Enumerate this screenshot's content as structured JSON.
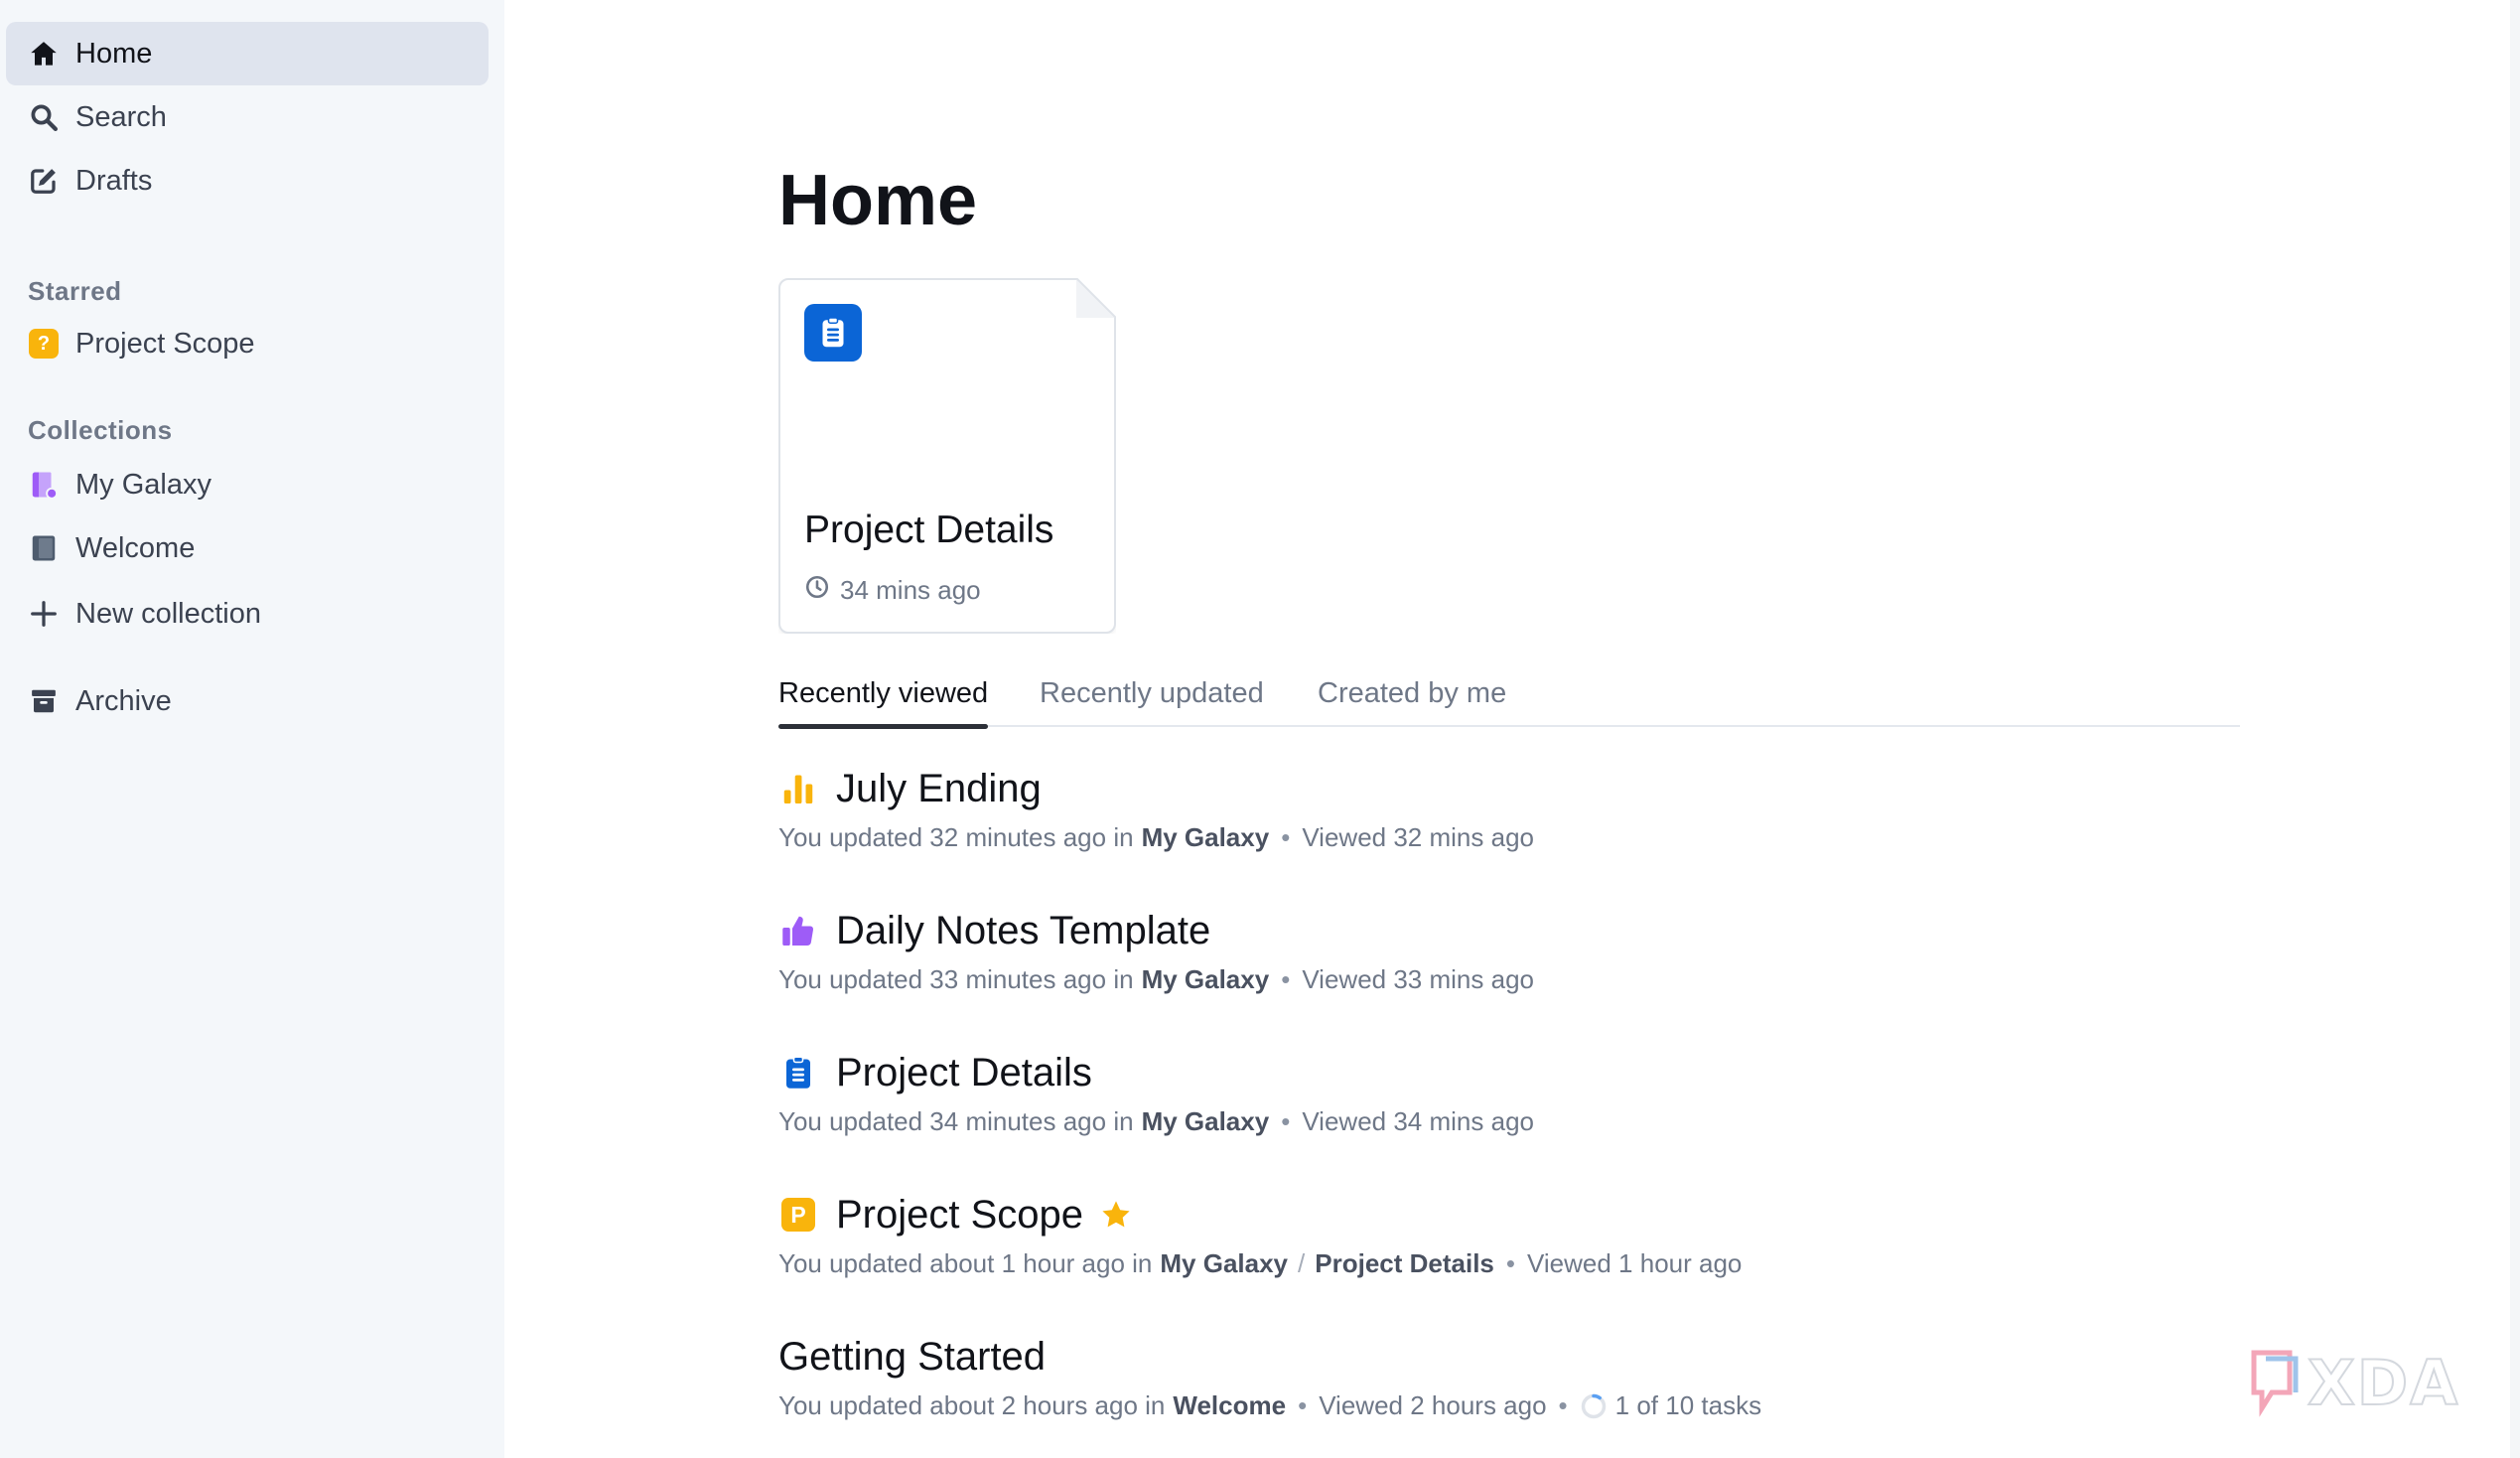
{
  "sidebar": {
    "nav": [
      {
        "label": "Home",
        "icon": "home-icon",
        "active": true
      },
      {
        "label": "Search",
        "icon": "search-icon"
      },
      {
        "label": "Drafts",
        "icon": "edit-icon"
      }
    ],
    "starred_title": "Starred",
    "starred": [
      {
        "label": "Project Scope",
        "icon": "question-badge-icon",
        "icon_text": "?"
      }
    ],
    "collections_title": "Collections",
    "collections": [
      {
        "label": "My Galaxy",
        "icon": "collection-private-icon",
        "color": "#9e5cf7"
      },
      {
        "label": "Welcome",
        "icon": "collection-icon",
        "color": "#4e5c6e"
      }
    ],
    "new_collection": "New collection",
    "archive": "Archive"
  },
  "main": {
    "title": "Home",
    "card": {
      "title": "Project Details",
      "meta": "34 mins ago"
    },
    "tabs": [
      {
        "label": "Recently viewed",
        "active": true
      },
      {
        "label": "Recently updated"
      },
      {
        "label": "Created by me"
      }
    ],
    "documents": [
      {
        "title": "July Ending",
        "icon": "bar-chart-icon",
        "updated": "You updated 32 minutes ago in",
        "collection": "My Galaxy",
        "viewed": "Viewed 32 mins ago"
      },
      {
        "title": "Daily Notes Template",
        "icon": "thumbs-up-icon",
        "updated": "You updated 33 minutes ago in",
        "collection": "My Galaxy",
        "viewed": "Viewed 33 mins ago"
      },
      {
        "title": "Project Details",
        "icon": "clipboard-icon",
        "updated": "You updated 34 minutes ago in",
        "collection": "My Galaxy",
        "viewed": "Viewed 34 mins ago"
      },
      {
        "title": "Project Scope",
        "icon": "p-badge-icon",
        "icon_text": "P",
        "starred": true,
        "updated": "You updated about 1 hour ago in",
        "collection": "My Galaxy",
        "parent": "Project Details",
        "slash": "/",
        "viewed": "Viewed 1 hour ago"
      },
      {
        "title": "Getting Started",
        "updated": "You updated about 2 hours ago in",
        "collection": "Welcome",
        "viewed": "Viewed 2 hours ago",
        "tasks": "1 of 10 tasks",
        "task_progress": 0.1
      }
    ],
    "separator": "•"
  },
  "colors": {
    "accent_yellow": "#f9b40c",
    "accent_blue": "#0b65d6",
    "accent_purple": "#9e5cf7",
    "active_bg": "#dfe4ee"
  }
}
